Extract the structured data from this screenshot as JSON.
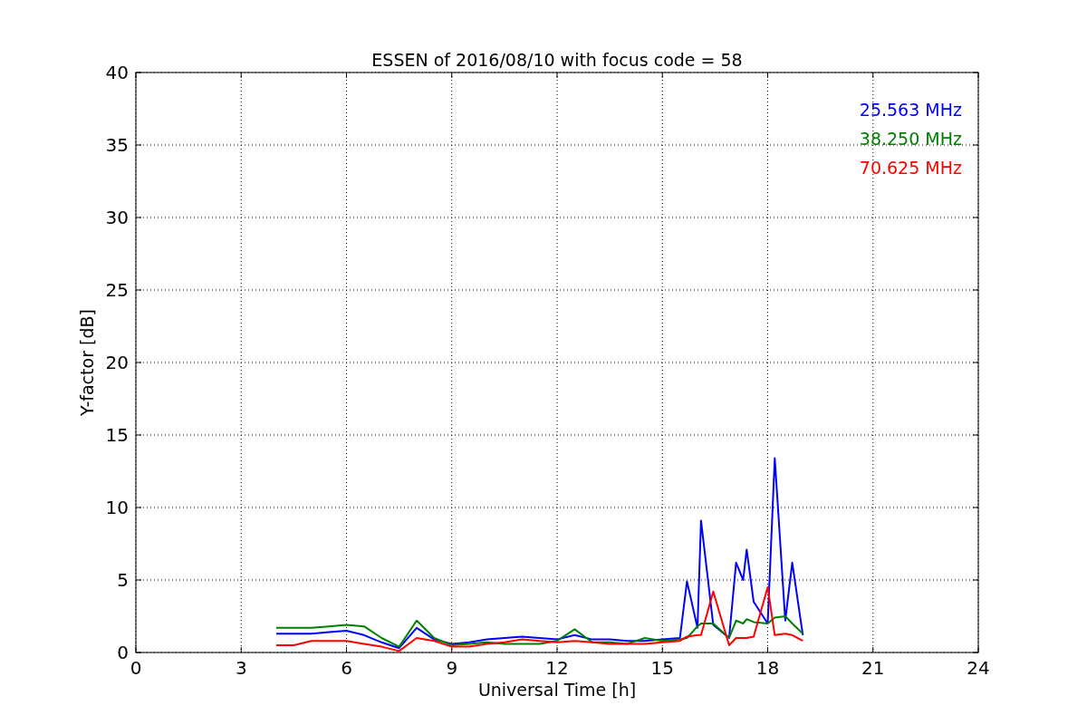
{
  "chart_data": {
    "type": "line",
    "title": "ESSEN of 2016/08/10 with focus code = 58",
    "xlabel": "Universal Time [h]",
    "ylabel": "Y-factor [dB]",
    "x": [
      4,
      4.5,
      5,
      5.5,
      6,
      6.5,
      7,
      7.5,
      8,
      8.5,
      9,
      9.5,
      10,
      10.5,
      11,
      11.5,
      12,
      12.5,
      13,
      13.5,
      14,
      14.5,
      15,
      15.5,
      15.7,
      16,
      16.1,
      16.45,
      16.9,
      17.1,
      17.3,
      17.4,
      17.6,
      18,
      18.2,
      18.5,
      18.7,
      19
    ],
    "series": [
      {
        "name": "25.563 MHz",
        "color": "#0000ff",
        "values": [
          1.3,
          1.3,
          1.3,
          1.4,
          1.5,
          1.2,
          0.7,
          0.3,
          1.7,
          0.9,
          0.6,
          0.7,
          0.9,
          1.0,
          1.1,
          1.0,
          0.9,
          1.2,
          0.9,
          0.9,
          0.8,
          0.8,
          0.9,
          1.0,
          4.9,
          1.7,
          9.1,
          1.9,
          1.0,
          6.2,
          5.0,
          7.1,
          3.5,
          2.0,
          13.4,
          2.2,
          6.2,
          1.2
        ]
      },
      {
        "name": "38.250 MHz",
        "color": "#008000",
        "values": [
          1.7,
          1.7,
          1.7,
          1.8,
          1.9,
          1.8,
          1.0,
          0.4,
          2.2,
          1.0,
          0.5,
          0.6,
          0.7,
          0.6,
          0.6,
          0.6,
          0.8,
          1.6,
          0.7,
          0.7,
          0.6,
          1.0,
          0.8,
          0.9,
          1.0,
          1.8,
          2.0,
          2.0,
          1.0,
          2.2,
          2.0,
          2.3,
          2.1,
          2.0,
          2.4,
          2.5,
          2.0,
          1.3
        ]
      },
      {
        "name": "70.625 MHz",
        "color": "#ff0000",
        "values": [
          0.5,
          0.5,
          0.8,
          0.8,
          0.8,
          0.6,
          0.4,
          0.1,
          1.0,
          0.8,
          0.4,
          0.4,
          0.6,
          0.7,
          0.9,
          0.8,
          0.7,
          0.8,
          0.7,
          0.6,
          0.6,
          0.6,
          0.7,
          0.8,
          1.1,
          1.2,
          1.2,
          4.2,
          0.5,
          1.0,
          1.0,
          1.0,
          1.1,
          4.5,
          1.2,
          1.3,
          1.2,
          0.8
        ]
      }
    ],
    "xlim": [
      0,
      24
    ],
    "ylim": [
      0,
      40
    ],
    "xticks": [
      0,
      3,
      6,
      9,
      12,
      15,
      18,
      21,
      24
    ],
    "yticks": [
      0,
      5,
      10,
      15,
      20,
      25,
      30,
      35,
      40
    ],
    "grid": true
  }
}
